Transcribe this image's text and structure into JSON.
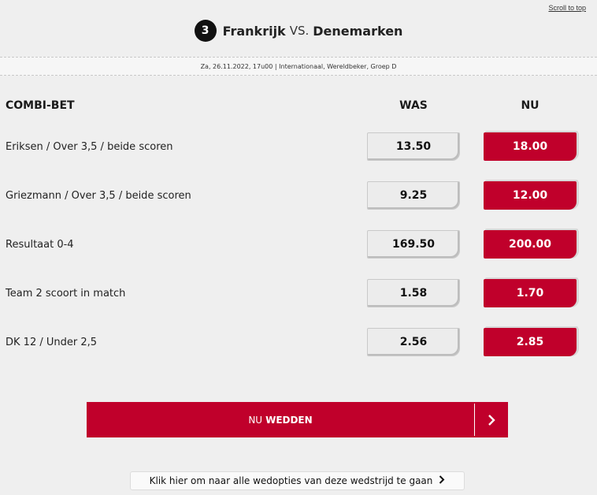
{
  "scroll_top": "Scroll to top",
  "match": {
    "number": "3",
    "home": "Frankrijk",
    "vs": "VS.",
    "away": "Denemarken",
    "meta": "Za, 26.11.2022, 17u00 | Internationaal, Wereldbeker, Groep D"
  },
  "table": {
    "title": "COMBI-BET",
    "was_header": "WAS",
    "nu_header": "NU",
    "rows": [
      {
        "label": "Eriksen / Over 3,5 / beide scoren",
        "was": "13.50",
        "nu": "18.00"
      },
      {
        "label": "Griezmann / Over 3,5 / beide scoren",
        "was": "9.25",
        "nu": "12.00"
      },
      {
        "label": "Resultaat 0-4",
        "was": "169.50",
        "nu": "200.00"
      },
      {
        "label": "Team 2 scoort in match",
        "was": "1.58",
        "nu": "1.70"
      },
      {
        "label": "DK 12 / Under 2,5",
        "was": "2.56",
        "nu": "2.85"
      }
    ]
  },
  "bet_button": {
    "prefix": "NU",
    "main": "WEDDEN",
    "icon": "chevron-right-icon"
  },
  "all_options": {
    "label": "Klik hier om naar alle wedopties van deze wedstrijd te gaan",
    "icon": "chevron-right-icon"
  },
  "colors": {
    "accent": "#c0002b",
    "background": "#efefef"
  }
}
